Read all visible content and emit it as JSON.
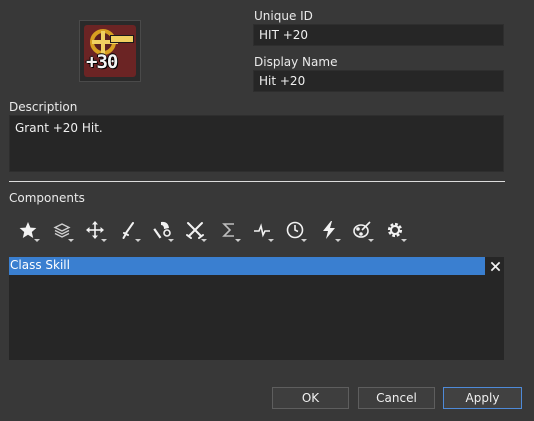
{
  "skill": {
    "icon": "hit-bonus-crosshair-icon",
    "icon_text": "+30"
  },
  "fields": {
    "unique_id_label": "Unique ID",
    "unique_id_value": "HIT +20",
    "display_name_label": "Display Name",
    "display_name_value": "Hit +20",
    "description_label": "Description",
    "description_value": "Grant +20 Hit."
  },
  "components": {
    "label": "Components",
    "toolbar": [
      {
        "icon": "star-icon"
      },
      {
        "icon": "layers-icon"
      },
      {
        "icon": "move-arrows-icon"
      },
      {
        "icon": "sword-icon"
      },
      {
        "icon": "axe-wrench-icon"
      },
      {
        "icon": "crossed-swords-icon"
      },
      {
        "icon": "sigma-icon"
      },
      {
        "icon": "pulse-icon"
      },
      {
        "icon": "clock-icon"
      },
      {
        "icon": "lightning-icon"
      },
      {
        "icon": "palette-brush-icon"
      },
      {
        "icon": "gear-icon"
      }
    ],
    "items": [
      {
        "label": "Class Skill",
        "selected": true
      }
    ]
  },
  "buttons": {
    "ok": "OK",
    "cancel": "Cancel",
    "apply": "Apply"
  },
  "colors": {
    "background": "#383838",
    "field": "#262626",
    "selection": "#3a7fd0",
    "apply_border": "#4e8ad8"
  }
}
